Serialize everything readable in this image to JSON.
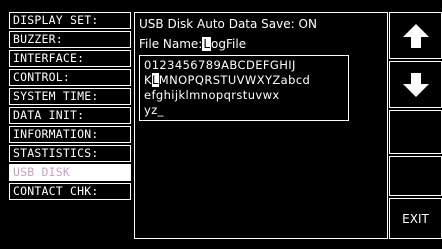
{
  "menu": {
    "items": [
      {
        "label": "DISPLAY SET:"
      },
      {
        "label": "BUZZER:"
      },
      {
        "label": "INTERFACE:"
      },
      {
        "label": "CONTROL:"
      },
      {
        "label": "SYSTEM TIME:"
      },
      {
        "label": "DATA INIT:"
      },
      {
        "label": "INFORMATION:"
      },
      {
        "label": "STASTISTICS:"
      },
      {
        "label": "USB DISK"
      },
      {
        "label": "CONTACT CHK:"
      }
    ],
    "active_index": 8
  },
  "panel": {
    "status_text": "USB Disk Auto Data Save: ON",
    "file_name_label": "File Name:",
    "file_name_cursor_char": "L",
    "file_name_rest": "ogFile",
    "char_rows": [
      {
        "before": "0123456789ABCDEFGHIJ",
        "selected": "",
        "after": ""
      },
      {
        "before": "K",
        "selected": "L",
        "after": "MNOPQRSTUVWXYZabcd"
      },
      {
        "before": "efghijklmnopqrstuvwx",
        "selected": "",
        "after": ""
      },
      {
        "before": "yz_",
        "selected": "",
        "after": ""
      }
    ]
  },
  "softkeys": {
    "up_icon": "up-arrow-icon",
    "down_icon": "down-arrow-icon",
    "key3_label": "",
    "key4_label": "",
    "exit_label": "EXIT"
  },
  "colors": {
    "background": "#000000",
    "foreground": "#ffffff",
    "active_text": "#c8a0c8"
  }
}
